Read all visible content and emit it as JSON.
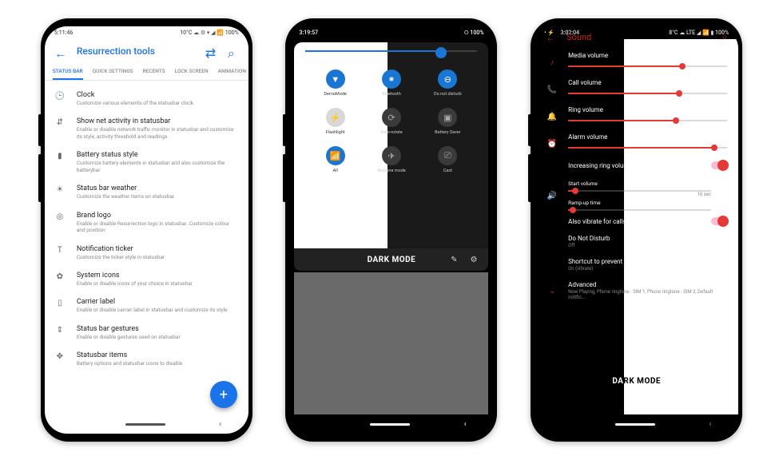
{
  "p1": {
    "status": {
      "time": "5:11:46",
      "right": "10°C ☁ ⚙ ▾ ◢ 📶 100%"
    },
    "title": "Resurrection tools",
    "tabs": [
      "STATUS BAR",
      "QUICK SETTINGS",
      "RECENTS",
      "LOCK SCREEN",
      "ANIMATION"
    ],
    "items": [
      {
        "icon": "🕒",
        "t": "Clock",
        "s": "Customize various elements of the statusbar clock"
      },
      {
        "icon": "⇵",
        "t": "Show net activity in statusbar",
        "s": "Enable or disable network traffic monitor in statusbar and customize its style, activity threshold and readings"
      },
      {
        "icon": "▮",
        "t": "Battery status style",
        "s": "Customize battery elements in statusbar and also customize the batterybar"
      },
      {
        "icon": "☀",
        "t": "Status bar weather",
        "s": "Customize the weather items on statusbar"
      },
      {
        "icon": "◎",
        "t": "Brand logo",
        "s": "Enable or disable Resurrection logo in statusbar. Customize colour and position"
      },
      {
        "icon": "T",
        "t": "Notification ticker",
        "s": "Customize the ticker style in statusbar"
      },
      {
        "icon": "✿",
        "t": "System icons",
        "s": "Enable or disable icons of your choice in statusbar"
      },
      {
        "icon": "▯",
        "t": "Carrier label",
        "s": "Enable or disable carrier label in statusbar and customize its style"
      },
      {
        "icon": "⇕",
        "t": "Status bar gestures",
        "s": "Enable or disable gestures used on statusbar"
      },
      {
        "icon": "✥",
        "t": "Statusbar items",
        "s": "Battery options and statusbar icons to disable"
      }
    ]
  },
  "p2": {
    "status": {
      "time": "3:19:57",
      "right": "⭘ 100%"
    },
    "tiles": [
      {
        "n": "DemoMode",
        "on": true,
        "side": "left",
        "g": "▼"
      },
      {
        "n": "Bluetooth",
        "on": true,
        "side": "right",
        "g": "⁕"
      },
      {
        "n": "Do not disturb",
        "on": true,
        "side": "right",
        "g": "⊖"
      },
      {
        "n": "Flashlight",
        "on": false,
        "side": "left",
        "g": "⚡"
      },
      {
        "n": "Auto-rotate",
        "on": false,
        "side": "right",
        "g": "⟳"
      },
      {
        "n": "Battery Saver",
        "on": false,
        "side": "right",
        "g": "▣"
      },
      {
        "n": "All",
        "on": true,
        "side": "left",
        "g": "📶"
      },
      {
        "n": "Airplane mode",
        "on": false,
        "side": "right",
        "g": "✈"
      },
      {
        "n": "Cast",
        "on": false,
        "side": "right",
        "g": "⎚"
      }
    ],
    "dark_mode": "DARK MODE"
  },
  "p3": {
    "status": {
      "time": "3:02:04",
      "right": "8°C ☁ LTE ◢ 📶 ▮ 100%"
    },
    "title": "Sound",
    "vols": [
      {
        "icon": "♪",
        "n": "Media volume",
        "v": 72
      },
      {
        "icon": "📞",
        "n": "Call volume",
        "v": 70
      },
      {
        "icon": "🔔",
        "n": "Ring volume",
        "v": 68
      },
      {
        "icon": "⏰",
        "n": "Alarm volume",
        "v": 92
      }
    ],
    "inc_ring": "Increasing ring volume",
    "start_vol": {
      "label": "Start volume",
      "v": 5
    },
    "ramp": {
      "label": "Ramp-up time",
      "val": "10 sec",
      "v": 3
    },
    "also_vibrate": "Also vibrate for calls",
    "dnd": {
      "t": "Do Not Disturb",
      "s": "Off"
    },
    "shortcut": {
      "t": "Shortcut to prevent ringing",
      "s": "On (vibrate)"
    },
    "advanced": {
      "t": "Advanced",
      "s": "Now Playing, Phone ringtone - SIM 1, Phone ringtone - SIM 2, Default notific..."
    },
    "dark_mode": "DARK MODE"
  }
}
